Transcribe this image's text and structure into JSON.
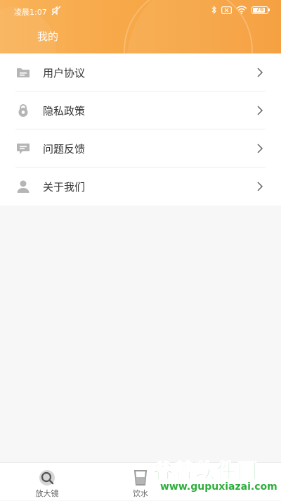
{
  "status_bar": {
    "time": "凌晨1:07",
    "battery": "76"
  },
  "header": {
    "title": "我的"
  },
  "menu": {
    "items": [
      {
        "label": "用户协议",
        "icon": "folder-icon"
      },
      {
        "label": "隐私政策",
        "icon": "lock-icon"
      },
      {
        "label": "问题反馈",
        "icon": "feedback-icon"
      },
      {
        "label": "关于我们",
        "icon": "person-icon"
      }
    ]
  },
  "tabbar": {
    "tabs": [
      {
        "label": "放大镜",
        "icon": "magnifier-icon"
      },
      {
        "label": "饮水",
        "icon": "water-cup-icon"
      }
    ]
  },
  "watermark": {
    "title": "谷普软件园",
    "url": "www.gupuxiazai.com"
  },
  "colors": {
    "accent": "#f7a746",
    "icon_gray": "#b5b5b5",
    "watermark_green": "#2eae3c"
  }
}
